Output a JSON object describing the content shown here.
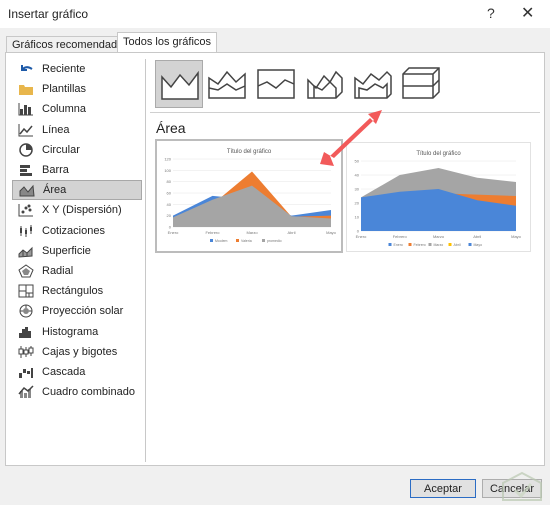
{
  "window": {
    "title": "Insertar gráfico",
    "help": "?",
    "close": "✕"
  },
  "tabs": [
    {
      "label": "Gráficos recomendados"
    },
    {
      "label": "Todos los gráficos"
    }
  ],
  "sidebar": {
    "items": [
      {
        "label": "Reciente",
        "icon": "undo-arrow-icon"
      },
      {
        "label": "Plantillas",
        "icon": "folder-icon"
      },
      {
        "label": "Columna",
        "icon": "column-chart-icon"
      },
      {
        "label": "Línea",
        "icon": "line-chart-icon"
      },
      {
        "label": "Circular",
        "icon": "pie-chart-icon"
      },
      {
        "label": "Barra",
        "icon": "bar-chart-icon"
      },
      {
        "label": "Área",
        "icon": "area-chart-icon",
        "selected": true
      },
      {
        "label": "X Y (Dispersión)",
        "icon": "scatter-chart-icon"
      },
      {
        "label": "Cotizaciones",
        "icon": "stock-chart-icon"
      },
      {
        "label": "Superficie",
        "icon": "surface-chart-icon"
      },
      {
        "label": "Radial",
        "icon": "radar-chart-icon"
      },
      {
        "label": "Rectángulos",
        "icon": "treemap-chart-icon"
      },
      {
        "label": "Proyección solar",
        "icon": "sunburst-chart-icon"
      },
      {
        "label": "Histograma",
        "icon": "histogram-chart-icon"
      },
      {
        "label": "Cajas y bigotes",
        "icon": "box-whisker-chart-icon"
      },
      {
        "label": "Cascada",
        "icon": "waterfall-chart-icon"
      },
      {
        "label": "Cuadro combinado",
        "icon": "combo-chart-icon"
      }
    ]
  },
  "subtypes": [
    "area",
    "stacked-area",
    "100-stacked-area",
    "3d-area",
    "3d-stacked-area",
    "3d-100-stacked-area"
  ],
  "section_title": "Área",
  "previews": [
    {
      "title": "Título del gráfico",
      "yticks": [
        "120",
        "100",
        "80",
        "60",
        "40",
        "20",
        "0"
      ],
      "xlabels": [
        "Enero",
        "Febrero",
        "Marzo",
        "Abril",
        "Mayo"
      ],
      "legend": [
        "Moolem",
        "Valeria",
        "promedio"
      ]
    },
    {
      "title": "Título del gráfico",
      "yticks": [
        "50",
        "40",
        "30",
        "20",
        "10",
        "0"
      ],
      "xlabels": [
        "Enero",
        "Febrero",
        "Marzo",
        "Abril",
        "Mayo"
      ],
      "legend": [
        "Enero",
        "Febrero",
        "Marzo",
        "Abril",
        "Mayo"
      ]
    }
  ],
  "chart_data": [
    {
      "type": "area",
      "title": "Título del gráfico",
      "categories": [
        "Enero",
        "Febrero",
        "Marzo",
        "Abril",
        "Mayo"
      ],
      "ylim": [
        0,
        120
      ],
      "series": [
        {
          "name": "Moolem",
          "values": [
            20,
            55,
            48,
            20,
            30
          ]
        },
        {
          "name": "Valeria",
          "values": [
            15,
            40,
            98,
            18,
            20
          ]
        },
        {
          "name": "promedio",
          "values": [
            17,
            48,
            73,
            19,
            15
          ]
        }
      ]
    },
    {
      "type": "area",
      "title": "Título del gráfico",
      "categories": [
        "Enero",
        "Febrero",
        "Marzo",
        "Abril",
        "Mayo"
      ],
      "ylim": [
        0,
        50
      ],
      "series": [
        {
          "name": "Enero",
          "values": [
            10,
            8,
            5,
            6,
            6
          ]
        },
        {
          "name": "Febrero",
          "values": [
            22,
            25,
            27,
            26,
            25
          ]
        },
        {
          "name": "Marzo",
          "values": [
            24,
            40,
            45,
            38,
            35
          ]
        },
        {
          "name": "Abril",
          "values": [
            18,
            14,
            8,
            10,
            12
          ]
        },
        {
          "name": "Mayo",
          "values": [
            24,
            28,
            30,
            22,
            18
          ]
        }
      ]
    }
  ],
  "buttons": {
    "ok": "Aceptar",
    "cancel": "Cancelar"
  },
  "colors": {
    "blue": "#4a86d8",
    "orange": "#ed7d31",
    "gray": "#a5a5a5",
    "yellow": "#ffc000",
    "accent": "#2b6cc4",
    "arrow": "#f25a5a"
  }
}
